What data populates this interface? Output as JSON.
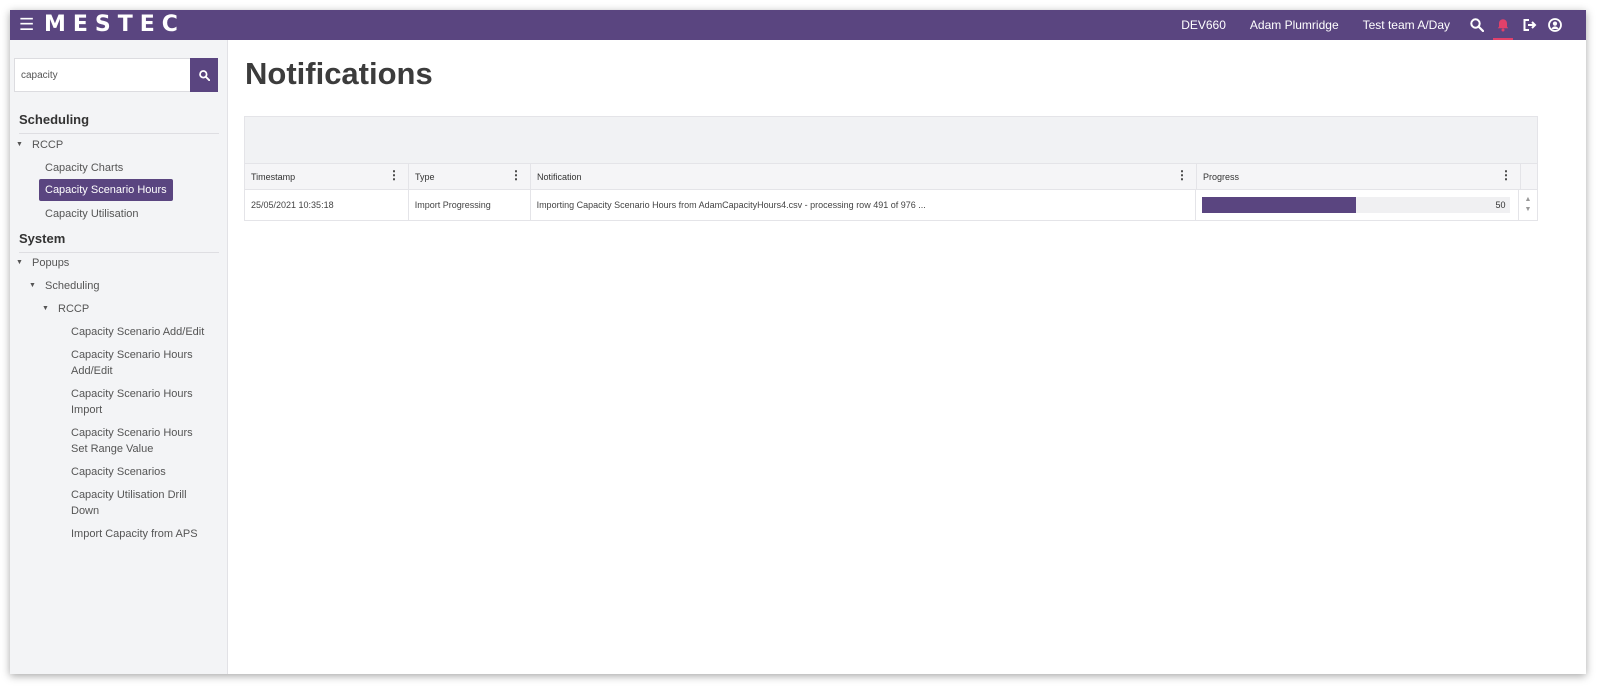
{
  "header": {
    "logo": "MESTEC",
    "environment": "DEV660",
    "user": "Adam Plumridge",
    "team": "Test team A/Day",
    "colors": {
      "brand": "#5a4580",
      "alert": "#e0416a"
    }
  },
  "sidebar": {
    "search_value": "capacity",
    "sections": [
      {
        "title": "Scheduling",
        "groups": [
          {
            "label": "RCCP",
            "items": [
              "Capacity Charts",
              "Capacity Scenario Hours",
              "Capacity Utilisation"
            ],
            "active_item": "Capacity Scenario Hours"
          }
        ]
      },
      {
        "title": "System",
        "groups": [
          {
            "label": "Popups",
            "children": [
              {
                "label": "Scheduling",
                "children": [
                  {
                    "label": "RCCP",
                    "items": [
                      "Capacity Scenario Add/Edit",
                      "Capacity Scenario Hours Add/Edit",
                      "Capacity Scenario Hours Import",
                      "Capacity Scenario Hours Set Range Value",
                      "Capacity Scenarios",
                      "Capacity Utilisation Drill Down",
                      "Import Capacity from APS"
                    ]
                  }
                ]
              }
            ]
          }
        ]
      }
    ]
  },
  "main": {
    "title": "Notifications",
    "columns": [
      "Timestamp",
      "Type",
      "Notification",
      "Progress"
    ],
    "rows": [
      {
        "timestamp": "25/05/2021 10:35:18",
        "type": "Import Progressing",
        "notification": "Importing Capacity Scenario Hours from AdamCapacityHours4.csv - processing row 491 of 976 ...",
        "progress": 50
      }
    ]
  }
}
